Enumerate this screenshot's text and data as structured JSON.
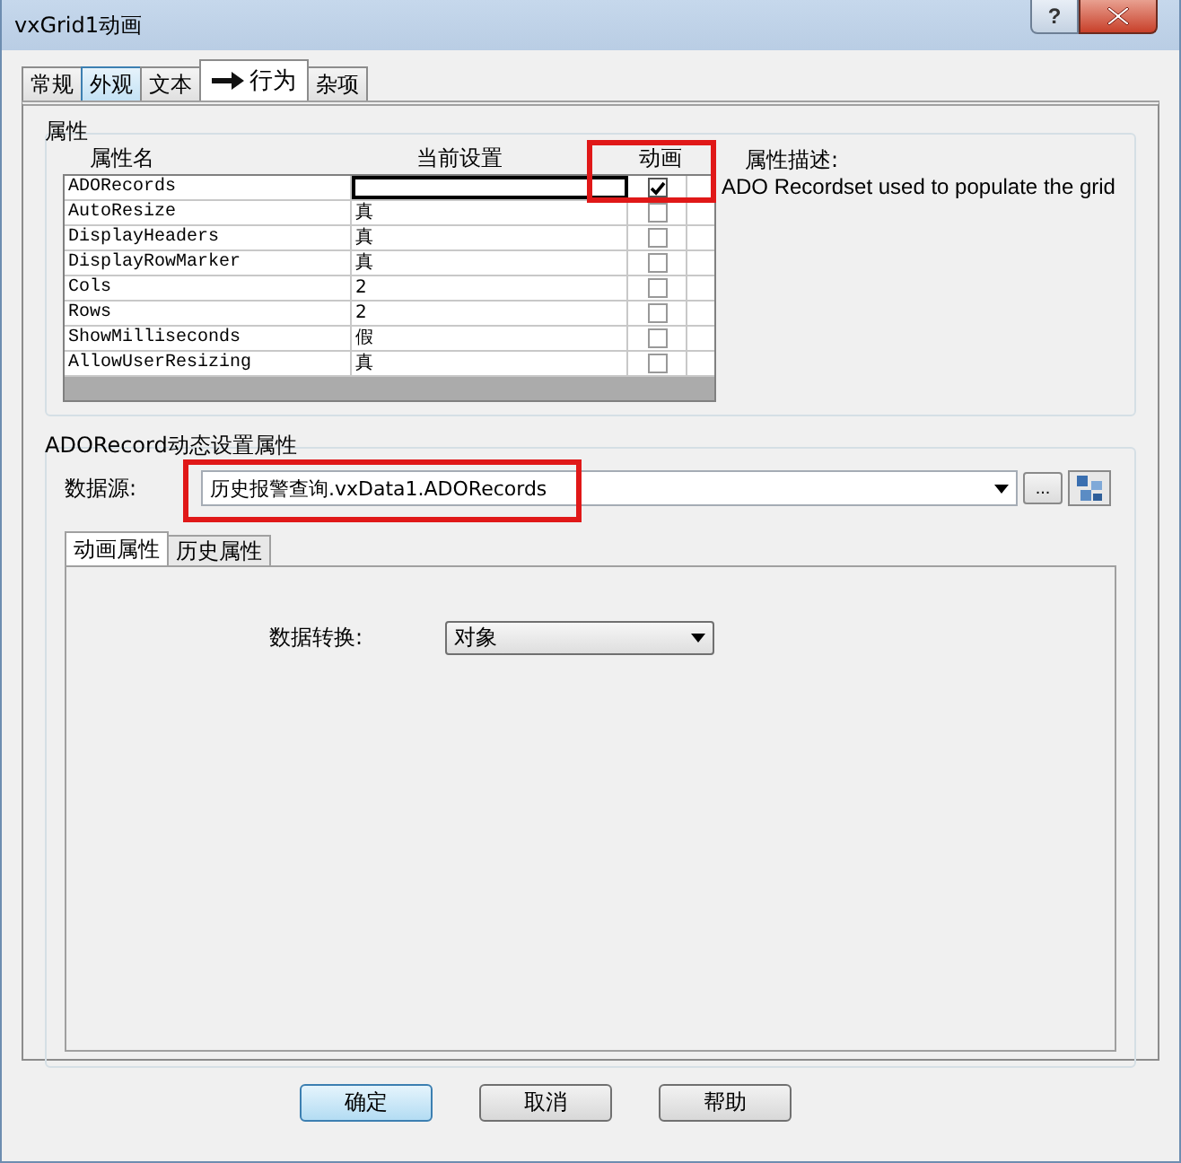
{
  "window": {
    "title": "vxGrid1动画",
    "help_label": "?"
  },
  "tabs": [
    {
      "label": "常规",
      "selected": false,
      "hovered": false
    },
    {
      "label": "外观",
      "selected": false,
      "hovered": true
    },
    {
      "label": "文本",
      "selected": false,
      "hovered": false
    },
    {
      "label": "行为",
      "selected": true,
      "hovered": false
    },
    {
      "label": "杂项",
      "selected": false,
      "hovered": false
    }
  ],
  "properties": {
    "title": "属性",
    "columns": [
      "属性名",
      "当前设置",
      "动画"
    ],
    "rows": [
      {
        "name": "ADORecords",
        "animated": true,
        "selected": true
      },
      {
        "name": "AutoResize",
        "value": "真",
        "animated": false,
        "selected": false
      },
      {
        "name": "DisplayHeaders",
        "value": "真",
        "animated": false,
        "selected": false
      },
      {
        "name": "DisplayRowMarker",
        "value": "真",
        "animated": false,
        "selected": false
      },
      {
        "name": "Cols",
        "value": "2",
        "animated": false,
        "selected": false
      },
      {
        "name": "Rows",
        "value": "2",
        "animated": false,
        "selected": false
      },
      {
        "name": "ShowMilliseconds",
        "value": "假",
        "animated": false,
        "selected": false
      },
      {
        "name": "AllowUserResizing",
        "value": "真",
        "animated": false,
        "selected": false
      }
    ],
    "description_label": "属性描述:",
    "description": "ADO Recordset used to populate the grid"
  },
  "binding": {
    "title": "ADORecord动态设置属性",
    "source_label": "数据源:",
    "source_value": "历史报警查询.vxData1.ADORecords",
    "browse_label": "...",
    "tabs": [
      {
        "label": "动画属性",
        "selected": true
      },
      {
        "label": "历史属性",
        "selected": false
      }
    ],
    "conversion_label": "数据转换:",
    "conversion_value": "对象"
  },
  "buttons": [
    {
      "label": "确定",
      "default": true
    },
    {
      "label": "取消",
      "default": false
    },
    {
      "label": "帮助",
      "default": false
    }
  ]
}
